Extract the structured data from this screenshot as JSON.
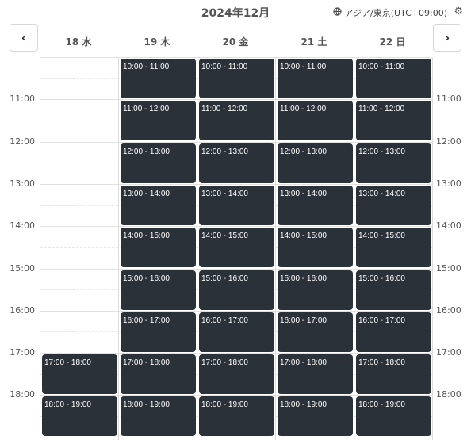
{
  "header": {
    "title": "2024年12月",
    "timezone": "アジア/東京(UTC+09:00)",
    "timezone_icon": "globe-icon",
    "settings_icon": "gear-icon",
    "prev_label": "‹",
    "next_label": "›"
  },
  "days": [
    {
      "label": "18 水"
    },
    {
      "label": "19 木"
    },
    {
      "label": "20 金"
    },
    {
      "label": "21 土"
    },
    {
      "label": "22 日"
    }
  ],
  "hour_labels": [
    "11:00",
    "12:00",
    "13:00",
    "14:00",
    "15:00",
    "16:00",
    "17:00",
    "18:00"
  ],
  "slot_times": [
    "10:00 - 11:00",
    "11:00 - 12:00",
    "12:00 - 13:00",
    "13:00 - 14:00",
    "14:00 - 15:00",
    "15:00 - 16:00",
    "16:00 - 17:00",
    "17:00 - 18:00",
    "18:00 - 19:00"
  ],
  "slots": [
    {
      "day": 0,
      "times": [
        "17:00 - 18:00",
        "18:00 - 19:00"
      ]
    },
    {
      "day": 1,
      "times": [
        "10:00 - 11:00",
        "11:00 - 12:00",
        "12:00 - 13:00",
        "13:00 - 14:00",
        "14:00 - 15:00",
        "15:00 - 16:00",
        "16:00 - 17:00",
        "17:00 - 18:00",
        "18:00 - 19:00"
      ]
    },
    {
      "day": 2,
      "times": [
        "10:00 - 11:00",
        "11:00 - 12:00",
        "12:00 - 13:00",
        "13:00 - 14:00",
        "14:00 - 15:00",
        "15:00 - 16:00",
        "16:00 - 17:00",
        "17:00 - 18:00",
        "18:00 - 19:00"
      ]
    },
    {
      "day": 3,
      "times": [
        "10:00 - 11:00",
        "11:00 - 12:00",
        "12:00 - 13:00",
        "13:00 - 14:00",
        "14:00 - 15:00",
        "15:00 - 16:00",
        "16:00 - 17:00",
        "17:00 - 18:00",
        "18:00 - 19:00"
      ]
    },
    {
      "day": 4,
      "times": [
        "10:00 - 11:00",
        "11:00 - 12:00",
        "12:00 - 13:00",
        "13:00 - 14:00",
        "14:00 - 15:00",
        "15:00 - 16:00",
        "16:00 - 17:00",
        "17:00 - 18:00",
        "18:00 - 19:00"
      ]
    }
  ],
  "colors": {
    "slot_bg": "#2b3138",
    "slot_text": "#ffffff"
  }
}
